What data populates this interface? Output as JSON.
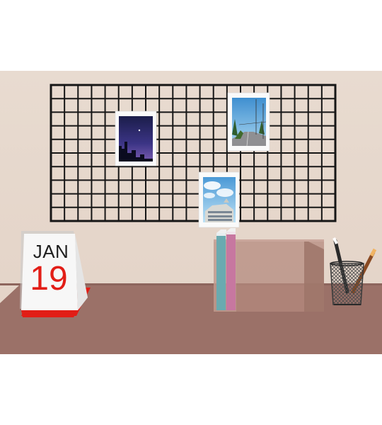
{
  "scene": {
    "description_colors": {
      "wall": "#e6d8cc",
      "desk": "#9b7168",
      "grid": "#161616",
      "calendar_accent": "#e21d16"
    },
    "calendar": {
      "month": "JAN",
      "day": "19"
    },
    "items": [
      "wire-grid-board",
      "night-sky-photo",
      "street-photo",
      "building-photo",
      "desk-calendar",
      "book-holder",
      "books",
      "pencil-cup"
    ]
  }
}
